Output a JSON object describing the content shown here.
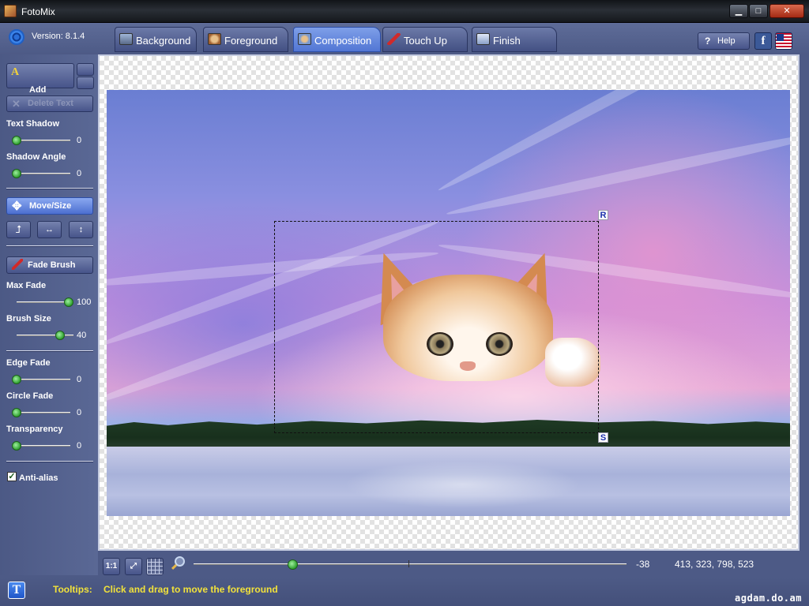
{
  "window": {
    "title": "FotoMix",
    "controls": {
      "minimize": "▁",
      "maximize": "□",
      "close": "✕"
    }
  },
  "header": {
    "version": "Version: 8.1.4",
    "tabs": [
      {
        "label": "Background",
        "icon": "background-icon",
        "active": false
      },
      {
        "label": "Foreground",
        "icon": "foreground-icon",
        "active": false
      },
      {
        "label": "Composition",
        "icon": "composition-icon",
        "active": true
      },
      {
        "label": "Touch Up",
        "icon": "brush-icon",
        "active": false
      },
      {
        "label": "Finish",
        "icon": "finish-icon",
        "active": false
      }
    ],
    "help_label": "Help",
    "facebook_label": "f"
  },
  "panel": {
    "add_text": "Add\nText",
    "delete_text": "Delete Text",
    "text_shadow": {
      "label": "Text Shadow",
      "value": "0"
    },
    "shadow_angle": {
      "label": "Shadow Angle",
      "value": "0"
    },
    "move_size": "Move/Size",
    "fade_brush": "Fade Brush",
    "max_fade": {
      "label": "Max Fade",
      "value": "100"
    },
    "brush_size": {
      "label": "Brush Size",
      "value": "40"
    },
    "edge_fade": {
      "label": "Edge Fade",
      "value": "0"
    },
    "circle_fade": {
      "label": "Circle Fade",
      "value": "0"
    },
    "transparency": {
      "label": "Transparency",
      "value": "0"
    },
    "anti_alias": {
      "label": "Anti-alias",
      "checked": true
    }
  },
  "canvas": {
    "handle_r": "R",
    "handle_s": "S"
  },
  "bottom": {
    "btn_actual": "1:1",
    "zoom_value": "-38",
    "coords": "413, 323, 798, 523"
  },
  "status": {
    "tooltips_label": "Tooltips:",
    "tooltip_text": "Click and drag to move the foreground",
    "t_button": "T",
    "watermark": "agdam.do.am"
  }
}
